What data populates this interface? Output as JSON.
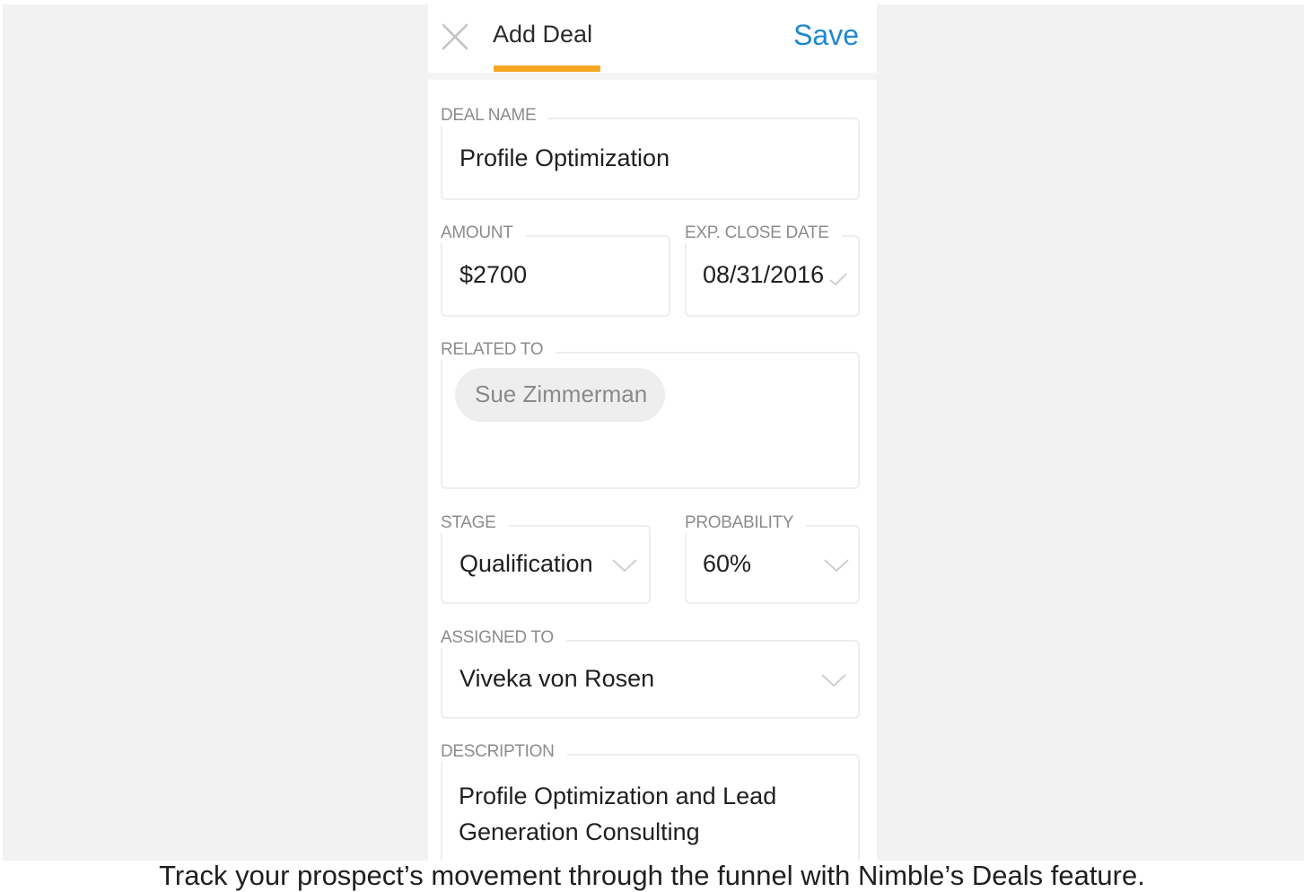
{
  "header": {
    "title": "Add Deal",
    "save_label": "Save",
    "close_icon": "close-icon",
    "accent_color": "#f5a623",
    "link_color": "#1e88d3"
  },
  "form": {
    "deal_name": {
      "label": "DEAL NAME",
      "value": "Profile Optimization"
    },
    "amount": {
      "label": "AMOUNT",
      "value": "$2700"
    },
    "close_date": {
      "label": "EXP. CLOSE DATE",
      "value": "08/31/2016",
      "icon": "checkmark-icon"
    },
    "related_to": {
      "label": "RELATED TO",
      "chips": [
        "Sue Zimmerman"
      ]
    },
    "stage": {
      "label": "STAGE",
      "value": "Qualification",
      "icon": "chevron-down-icon"
    },
    "probability": {
      "label": "PROBABILITY",
      "value": "60%",
      "icon": "chevron-down-icon"
    },
    "assigned_to": {
      "label": "ASSIGNED TO",
      "value": "Viveka von Rosen",
      "icon": "chevron-down-icon"
    },
    "description": {
      "label": "DESCRIPTION",
      "value": "Profile Optimization and Lead Generation Consulting"
    }
  },
  "caption": "Track your prospect’s movement through the funnel with Nimble’s Deals feature."
}
